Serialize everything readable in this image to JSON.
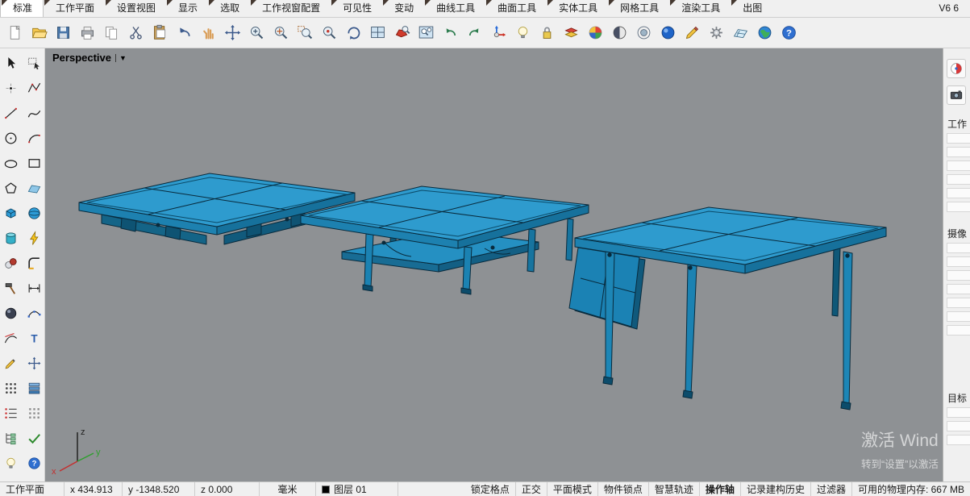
{
  "menu": {
    "tabs": [
      {
        "label": "标准",
        "active": true
      },
      {
        "label": "工作平面"
      },
      {
        "label": "设置视图"
      },
      {
        "label": "显示"
      },
      {
        "label": "选取"
      },
      {
        "label": "工作视窗配置"
      },
      {
        "label": "可见性"
      },
      {
        "label": "变动"
      },
      {
        "label": "曲线工具"
      },
      {
        "label": "曲面工具"
      },
      {
        "label": "实体工具"
      },
      {
        "label": "网格工具"
      },
      {
        "label": "渲染工具"
      },
      {
        "label": "出图"
      }
    ],
    "version": "V6 6"
  },
  "toolbar": {
    "icons": [
      "new-file",
      "open-file",
      "save-file",
      "print",
      "copy-to-clipboard",
      "cut",
      "paste",
      "undo",
      "pan-hand",
      "pan-view",
      "zoom",
      "zoom-dynamic",
      "zoom-window",
      "zoom-selected",
      "rotate-view",
      "viewport-layout",
      "zoom-extents",
      "zoom-extents-all",
      "undo-view",
      "redo-view",
      "gumball",
      "visibility-lamp",
      "lock",
      "layer-state",
      "color-wheel",
      "shaded-display",
      "ghosted-display",
      "rendered-display",
      "annotate-pen",
      "options-gear",
      "cplane-tool",
      "world-view",
      "help"
    ]
  },
  "sidebar": {
    "tools": [
      "select-tool",
      "marquee-select-tool",
      "point-tool",
      "polyline-tool",
      "line-tool",
      "curve-tool",
      "circle-tool",
      "arc-tool",
      "ellipse-tool",
      "rectangle-tool",
      "polygon-tool",
      "plane-surface-tool",
      "box-tool",
      "sphere-tool",
      "cylinder-tool",
      "boolean-tool",
      "osnap-tool",
      "fillet-tool",
      "trim-tool",
      "dimension-tool",
      "shade-tool",
      "point-edit-tool",
      "tangent-tool",
      "text-tool",
      "pencil-tool",
      "move-tool",
      "array-tool",
      "layer-tool",
      "list-tool",
      "grid-tool",
      "tree-tool",
      "check-tool",
      "lamp-tool",
      "help-tool"
    ]
  },
  "viewport": {
    "title": "Perspective",
    "dropdown_glyph": "▼",
    "axis_x": "x",
    "axis_y": "y",
    "axis_z": "z",
    "background": "#8e9194",
    "model_color": "#2e9bce",
    "watermark_line1": "激活 Wind",
    "watermark_line2": "转到“设置”以激活"
  },
  "right_panel": {
    "tabs": [
      "properties-tab",
      "camera-tab"
    ],
    "sections": [
      "工作",
      "摄像",
      "目标"
    ]
  },
  "status": {
    "cplane": "工作平面",
    "x": "x 434.913",
    "y": "y -1348.520",
    "z": "z 0.000",
    "units": "毫米",
    "layer": "图层 01",
    "layer_color": "#000000",
    "toggles": [
      {
        "label": "锁定格点"
      },
      {
        "label": "正交"
      },
      {
        "label": "平面模式"
      },
      {
        "label": "物件锁点"
      },
      {
        "label": "智慧轨迹"
      },
      {
        "label": "操作轴",
        "active": true
      },
      {
        "label": "记录建构历史"
      },
      {
        "label": "过滤器"
      }
    ],
    "memory": "可用的物理内存: 667 MB"
  }
}
